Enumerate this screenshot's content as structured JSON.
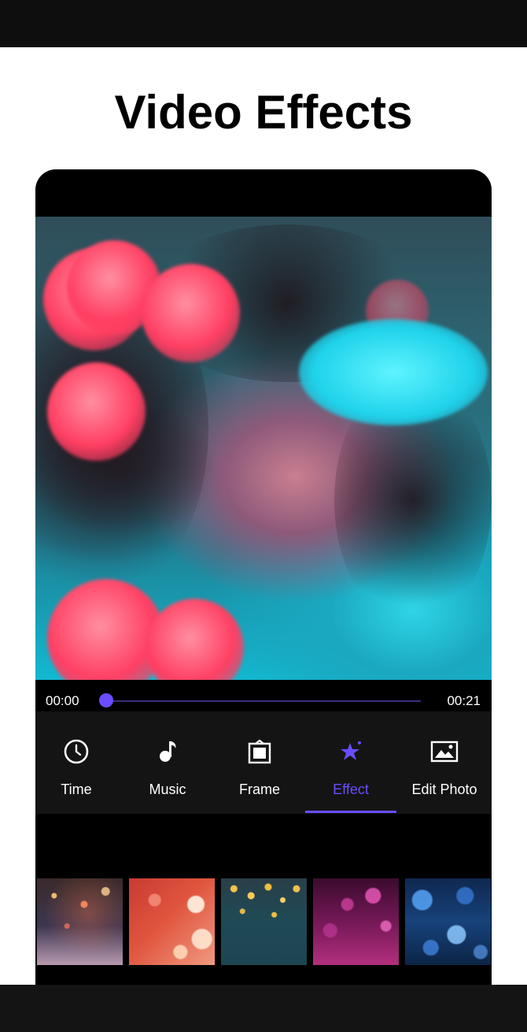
{
  "headline": "Video Effects",
  "player": {
    "current_time": "00:00",
    "total_time": "00:21",
    "progress": 0.0
  },
  "tools": [
    {
      "label": "Time",
      "icon": "clock-icon",
      "active": false
    },
    {
      "label": "Music",
      "icon": "music-note-icon",
      "active": false
    },
    {
      "label": "Frame",
      "icon": "frame-icon",
      "active": false
    },
    {
      "label": "Effect",
      "icon": "magic-wand-icon",
      "active": true
    },
    {
      "label": "Edit Photo",
      "icon": "image-icon",
      "active": false
    }
  ],
  "effect_presets": [
    {
      "name": "sparkle-bokeh"
    },
    {
      "name": "hearts-bokeh"
    },
    {
      "name": "gold-glitter"
    },
    {
      "name": "magenta-bokeh"
    },
    {
      "name": "blue-bokeh"
    }
  ],
  "colors": {
    "accent": "#6b4cff",
    "toolbar_bg": "#141414",
    "text_light": "#ffffff"
  }
}
